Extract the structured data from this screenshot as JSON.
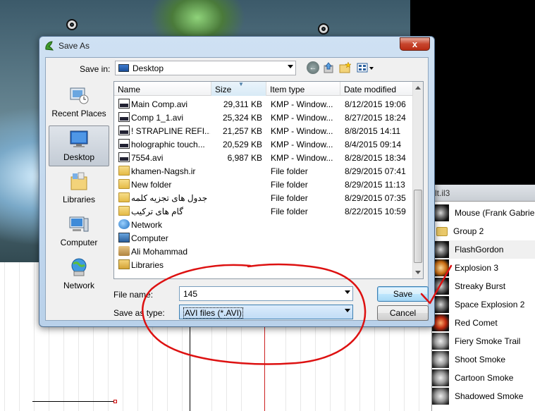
{
  "dialog": {
    "title": "Save As",
    "save_in_label": "Save in:",
    "save_in_value": "Desktop",
    "close_label": "x"
  },
  "places": [
    {
      "label": "Recent Places",
      "icon": "recent-places-icon"
    },
    {
      "label": "Desktop",
      "icon": "desktop-icon",
      "selected": true
    },
    {
      "label": "Libraries",
      "icon": "libraries-icon"
    },
    {
      "label": "Computer",
      "icon": "computer-icon"
    },
    {
      "label": "Network",
      "icon": "network-icon"
    }
  ],
  "columns": [
    "Name",
    "Size",
    "Item type",
    "Date modified"
  ],
  "files": [
    {
      "name": "Main Comp.avi",
      "size": "29,311 KB",
      "type": "KMP - Window...",
      "date": "8/12/2015 19:06",
      "icon": "avi-file-icon"
    },
    {
      "name": "Comp 1_1.avi",
      "size": "25,324 KB",
      "type": "KMP - Window...",
      "date": "8/27/2015 18:24",
      "icon": "avi-file-icon"
    },
    {
      "name": "!   STRAPLINE REFI...",
      "size": "21,257 KB",
      "type": "KMP - Window...",
      "date": "8/8/2015 14:11",
      "icon": "avi-file-icon"
    },
    {
      "name": "holographic touch...",
      "size": "20,529 KB",
      "type": "KMP - Window...",
      "date": "8/4/2015 09:14",
      "icon": "avi-file-icon"
    },
    {
      "name": "7554.avi",
      "size": "6,987 KB",
      "type": "KMP - Window...",
      "date": "8/28/2015 18:34",
      "icon": "avi-file-icon"
    },
    {
      "name": "khamen-Nagsh.ir",
      "size": "",
      "type": "File folder",
      "date": "8/29/2015 07:41",
      "icon": "folder-icon"
    },
    {
      "name": "New folder",
      "size": "",
      "type": "File folder",
      "date": "8/29/2015 11:13",
      "icon": "folder-icon"
    },
    {
      "name": "جدول های تجزیه کلمه",
      "size": "",
      "type": "File folder",
      "date": "8/29/2015 07:35",
      "icon": "folder-icon"
    },
    {
      "name": "گام های ترکیب",
      "size": "",
      "type": "File folder",
      "date": "8/22/2015 10:59",
      "icon": "folder-icon"
    },
    {
      "name": "Network",
      "size": "",
      "type": "",
      "date": "",
      "icon": "network-icon"
    },
    {
      "name": "Computer",
      "size": "",
      "type": "",
      "date": "",
      "icon": "computer-icon"
    },
    {
      "name": "Ali Mohammad",
      "size": "",
      "type": "",
      "date": "",
      "icon": "user-folder-icon"
    },
    {
      "name": "Libraries",
      "size": "",
      "type": "",
      "date": "",
      "icon": "libraries-icon"
    }
  ],
  "file_name_label": "File name:",
  "file_name_value": "145",
  "save_type_label": "Save as type:",
  "save_type_value": "AVI files (*.AVI)",
  "save_button": "Save",
  "cancel_button": "Cancel",
  "fx_panel": {
    "header": "lt.il3",
    "items": [
      {
        "label": "Mouse (Frank Gabriel)",
        "icon": "effect-thumb-icon"
      },
      {
        "label": "Group 2",
        "icon": "folder-icon"
      },
      {
        "label": "FlashGordon",
        "icon": "effect-thumb-icon",
        "selected": true
      },
      {
        "label": "Explosion 3",
        "icon": "effect-thumb-icon"
      },
      {
        "label": "Streaky Burst",
        "icon": "effect-thumb-icon"
      },
      {
        "label": "Space Explosion 2",
        "icon": "effect-thumb-icon"
      },
      {
        "label": "Red Comet",
        "icon": "effect-thumb-icon"
      },
      {
        "label": "Fiery Smoke Trail",
        "icon": "effect-thumb-icon"
      },
      {
        "label": "Shoot Smoke",
        "icon": "effect-thumb-icon"
      },
      {
        "label": "Cartoon Smoke",
        "icon": "effect-thumb-icon"
      },
      {
        "label": "Shadowed Smoke",
        "icon": "effect-thumb-icon"
      }
    ]
  },
  "colors": {
    "annotation": "#dd1111",
    "selection": "#c1dcf5"
  }
}
